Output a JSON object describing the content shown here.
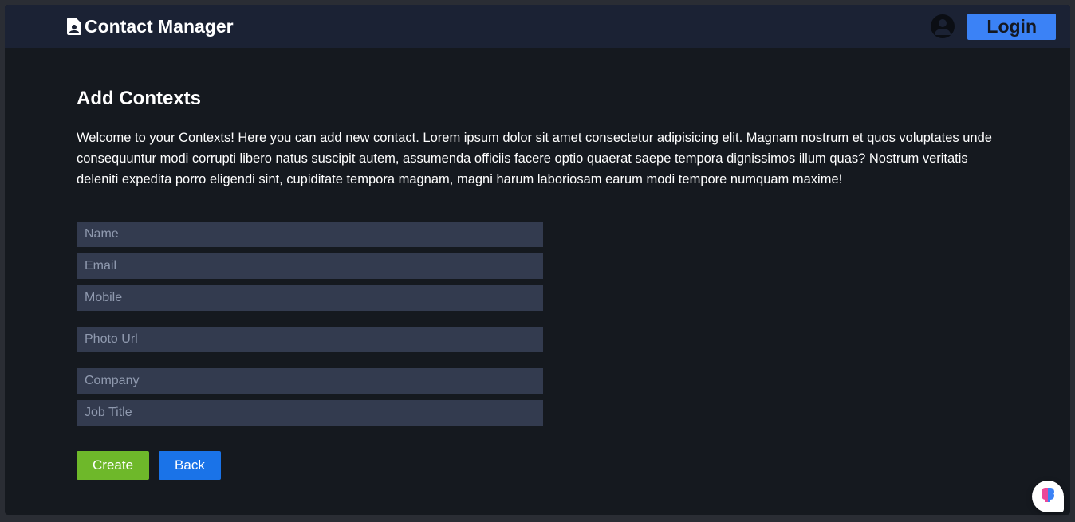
{
  "navbar": {
    "brand_text": "Contact Manager",
    "login_label": "Login"
  },
  "page": {
    "title": "Add Contexts",
    "description": "Welcome to your Contexts! Here you can add new contact. Lorem ipsum dolor sit amet consectetur adipisicing elit. Magnam nostrum et quos voluptates unde consequuntur modi corrupti libero natus suscipit autem, assumenda officiis facere optio quaerat saepe tempora dignissimos illum quas? Nostrum veritatis deleniti expedita porro eligendi sint, cupiditate tempora magnam, magni harum laboriosam earum modi tempore numquam maxime!"
  },
  "form": {
    "fields": {
      "name": {
        "placeholder": "Name",
        "value": ""
      },
      "email": {
        "placeholder": "Email",
        "value": ""
      },
      "mobile": {
        "placeholder": "Mobile",
        "value": ""
      },
      "photo_url": {
        "placeholder": "Photo Url",
        "value": ""
      },
      "company": {
        "placeholder": "Company",
        "value": ""
      },
      "job_title": {
        "placeholder": "Job Title",
        "value": ""
      }
    },
    "buttons": {
      "create_label": "Create",
      "back_label": "Back"
    }
  },
  "colors": {
    "accent_blue": "#3b82f6",
    "button_green": "#6eb82a",
    "button_blue": "#1a73e8",
    "input_bg": "#333b4f",
    "navbar_bg": "#1b2234",
    "body_bg": "#15191f"
  }
}
